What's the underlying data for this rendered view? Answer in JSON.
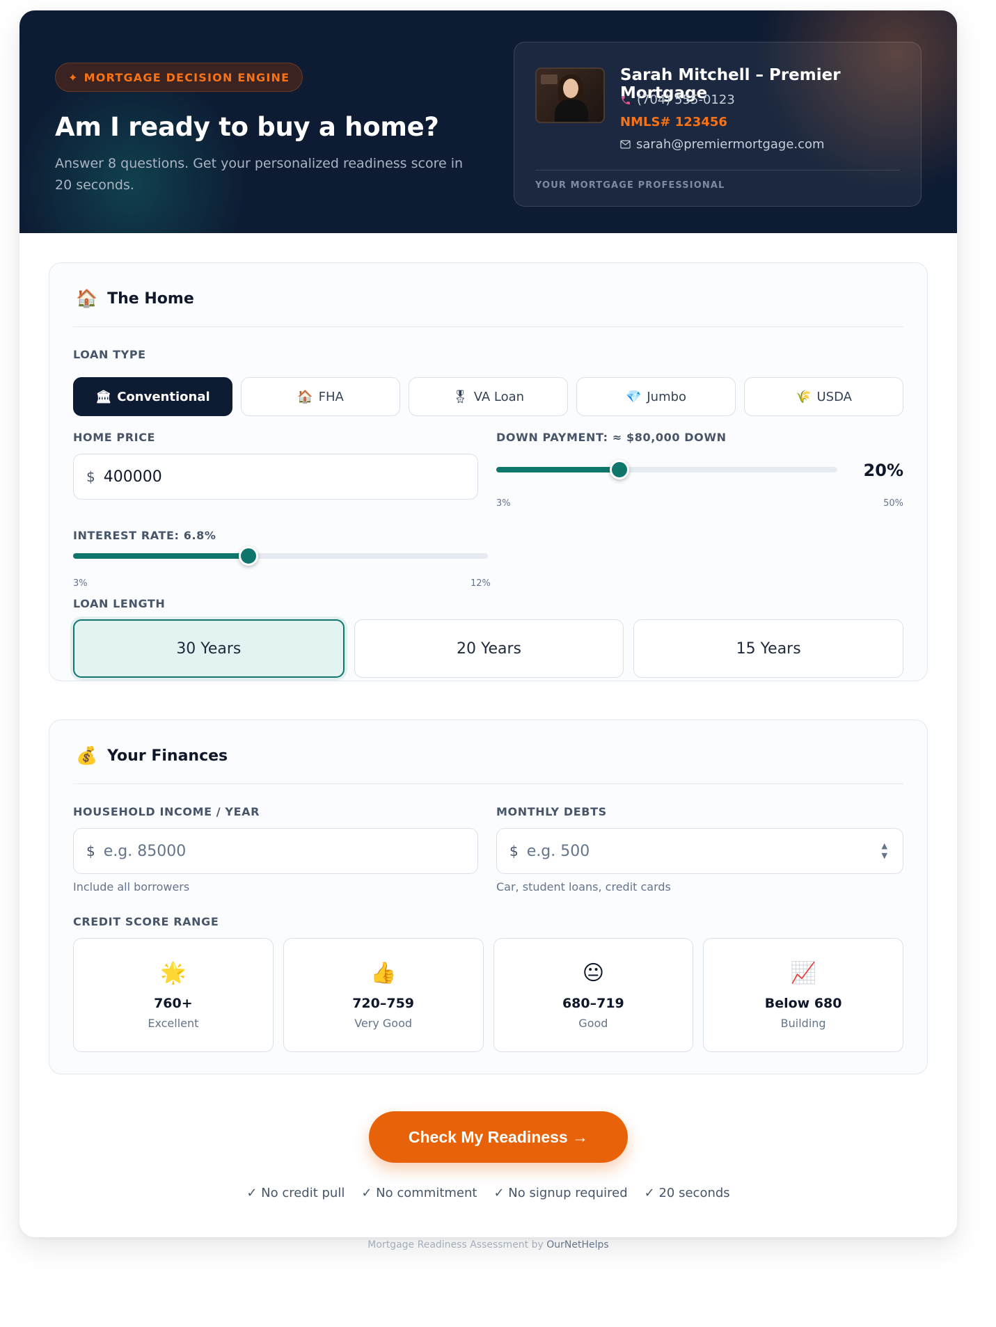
{
  "hero": {
    "badge_icon": "✦",
    "badge": "MORTGAGE DECISION ENGINE",
    "title": "Am I ready to buy a home?",
    "subtitle": "Answer 8 questions. Get your personalized readiness score in 20 seconds."
  },
  "professional": {
    "name": "Sarah Mitchell – Premier Mortgage",
    "phone": "(704) 555-0123",
    "nmls": "NMLS# 123456",
    "email": "sarah@premiermortgage.com",
    "caption": "YOUR MORTGAGE PROFESSIONAL"
  },
  "home": {
    "title": "The Home",
    "emoji": "🏠",
    "loan_type_label": "LOAN TYPE",
    "loan_types": [
      {
        "icon": "🏛",
        "label": "Conventional",
        "active": true
      },
      {
        "icon": "🏠",
        "label": "FHA",
        "active": false
      },
      {
        "icon": "🎖",
        "label": "VA Loan",
        "active": false
      },
      {
        "icon": "💎",
        "label": "Jumbo",
        "active": false
      },
      {
        "icon": "🌾",
        "label": "USDA",
        "active": false
      }
    ],
    "home_price_label": "HOME PRICE",
    "currency": "$",
    "home_price_value": "400000",
    "down_payment_label": "DOWN PAYMENT: ≈ $80,000 DOWN",
    "down_payment_display": "20%",
    "down_payment_percent": 20,
    "down_payment_min": "3%",
    "down_payment_max": "50%",
    "interest_label": "INTEREST RATE: 6.8%",
    "interest_rate": 6.8,
    "interest_min": "3%",
    "interest_max": "12%",
    "loan_length_label": "LOAN LENGTH",
    "loan_lengths": [
      {
        "label": "30 Years",
        "active": true
      },
      {
        "label": "20 Years",
        "active": false
      },
      {
        "label": "15 Years",
        "active": false
      }
    ]
  },
  "finances": {
    "title": "Your Finances",
    "emoji": "💰",
    "income_label": "HOUSEHOLD INCOME / YEAR",
    "income_placeholder": "e.g. 85000",
    "income_hint": "Include all borrowers",
    "debts_label": "MONTHLY DEBTS",
    "debts_placeholder": "e.g. 500",
    "debts_hint": "Car, student loans, credit cards",
    "credit_label": "CREDIT SCORE RANGE",
    "credit_options": [
      {
        "emoji": "🌟",
        "range": "760+",
        "desc": "Excellent"
      },
      {
        "emoji": "👍",
        "range": "720–759",
        "desc": "Very Good"
      },
      {
        "emoji": "😐",
        "range": "680–719",
        "desc": "Good"
      },
      {
        "emoji": "📈",
        "range": "Below 680",
        "desc": "Building"
      }
    ]
  },
  "cta": {
    "label": "Check My Readiness →",
    "checks": [
      "✓ No credit pull",
      "✓ No commitment",
      "✓ No signup required",
      "✓ 20 seconds"
    ]
  },
  "footer": {
    "text": "Mortgage Readiness Assessment by",
    "brand": "OurNetHelps"
  },
  "colors": {
    "navy": "#0d1b33",
    "teal": "#0f766e",
    "orange": "#e8620a"
  }
}
